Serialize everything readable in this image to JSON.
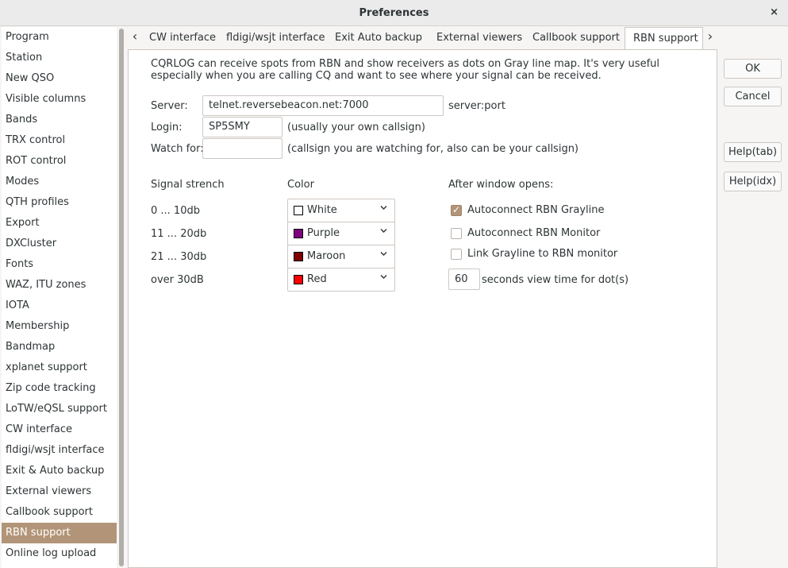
{
  "window": {
    "title": "Preferences",
    "close_glyph": "×"
  },
  "sidebar": {
    "items": [
      "Program",
      "Station",
      "New QSO",
      "Visible columns",
      "Bands",
      "TRX control",
      "ROT control",
      "Modes",
      "QTH profiles",
      "Export",
      "DXCluster",
      "Fonts",
      "WAZ, ITU zones",
      "IOTA",
      "Membership",
      "Bandmap",
      "xplanet support",
      "Zip code tracking",
      "LoTW/eQSL support",
      "CW interface",
      "fldigi/wsjt interface",
      "Exit & Auto backup",
      "External viewers",
      "Callbook support",
      "RBN support",
      "Online log upload"
    ],
    "selected": "RBN support"
  },
  "tabs": {
    "left_arrow": "‹",
    "right_arrow": "›",
    "items": [
      "CW interface",
      "fldigi/wsjt interface",
      "Exit  Auto backup",
      "External viewers",
      "Callbook support",
      "RBN support"
    ],
    "active": "RBN support"
  },
  "rbn": {
    "description_line1": "CQRLOG can receive spots from RBN and show receivers as dots on Gray line map. It's very useful",
    "description_line2": "especially when you are calling CQ and want to see where your signal can be received.",
    "server_label": "Server:",
    "server_value": "telnet.reversebeacon.net:7000",
    "server_hint": "server:port",
    "login_label": "Login:",
    "login_value": "SP5SMY",
    "login_hint": "(usually your own callsign)",
    "watch_label": "Watch for:",
    "watch_value": "",
    "watch_hint": "(callsign you are watching for, also can be your callsign)",
    "signal_header": "Signal strench",
    "color_header": "Color",
    "after_header": "After window opens:",
    "levels": [
      {
        "range": "0 ... 10db",
        "color_name": "White",
        "color": "#ffffff"
      },
      {
        "range": "11 ... 20db",
        "color_name": "Purple",
        "color": "#800080"
      },
      {
        "range": "21 ... 30db",
        "color_name": "Maroon",
        "color": "#800000"
      },
      {
        "range": "over 30dB",
        "color_name": "Red",
        "color": "#ff0000"
      }
    ],
    "options": [
      {
        "label": "Autoconnect RBN Grayline",
        "checked": true
      },
      {
        "label": "Autoconnect RBN Monitor",
        "checked": false
      },
      {
        "label": "Link Grayline to RBN monitor",
        "checked": false
      }
    ],
    "view_time_value": "60",
    "view_time_label": "seconds view time for dot(s)"
  },
  "buttons": {
    "ok": "OK",
    "cancel": "Cancel",
    "help_tab": "Help(tab)",
    "help_idx": "Help(idx)"
  },
  "icons": {
    "dropdown": "chevron-down-icon",
    "check": "check-icon"
  }
}
